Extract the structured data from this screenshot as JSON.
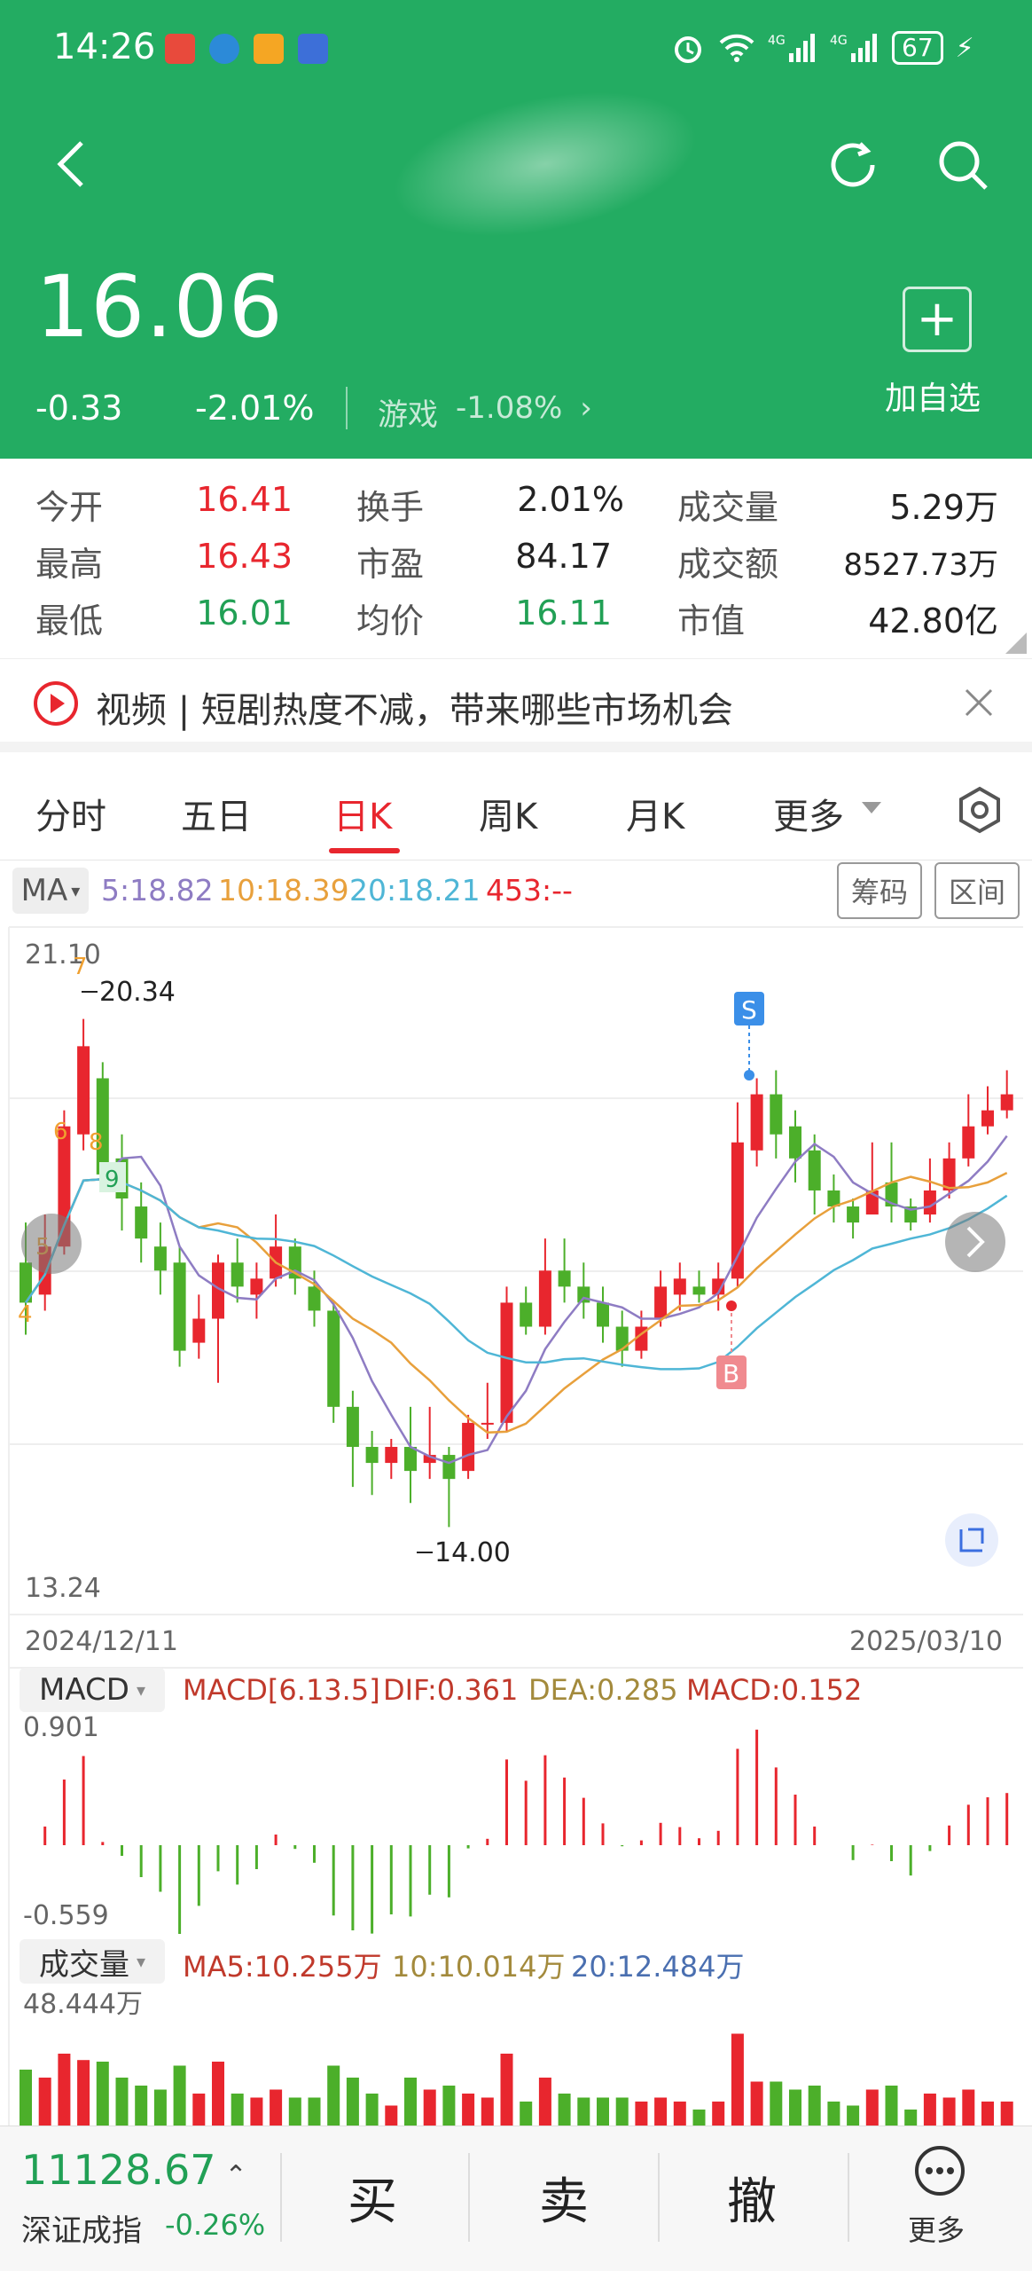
{
  "status_bar": {
    "time": "14:26",
    "battery": "67"
  },
  "header": {
    "price": "16.06",
    "change": "-0.33",
    "change_pct": "-2.01%",
    "sector_name": "游戏",
    "sector_pct": "-1.08%",
    "add_label": "加自选"
  },
  "quote": {
    "rows": [
      {
        "l1": "今开",
        "v1": "16.41",
        "l2": "换手",
        "v2": "2.01%",
        "l3": "成交量",
        "v3": "5.29万"
      },
      {
        "l1": "最高",
        "v1": "16.43",
        "l2": "市盈",
        "v2": "84.17",
        "l3": "成交额",
        "v3": "8527.73万"
      },
      {
        "l1": "最低",
        "v1": "16.01",
        "l2": "均价",
        "v2": "16.11",
        "l3": "市值",
        "v3": "42.80亿"
      }
    ]
  },
  "news": {
    "text": "视频 | 短剧热度不减，带来哪些市场机会"
  },
  "tabs": [
    "分时",
    "五日",
    "日K",
    "周K",
    "月K",
    "更多"
  ],
  "active_tab": "日K",
  "ma_bar": {
    "label": "MA",
    "ma5": "5:18.82",
    "ma10": "10:18.39",
    "ma20": "20:18.21",
    "ma453": "453:--",
    "chip_btn": "筹码",
    "range_btn": "区间"
  },
  "kline": {
    "y_max": "21.10",
    "y_min": "13.24",
    "y_mid": "17.17",
    "high_label": "20.34",
    "low_label": "14.00",
    "date_start": "2024/12/11",
    "date_end": "2025/03/10",
    "marker_s": "S",
    "marker_b": "B",
    "seq_labels": [
      "4",
      "5",
      "6",
      "7",
      "8",
      "9"
    ]
  },
  "macd_bar": {
    "label": "MACD",
    "params": "MACD[6.13.5]",
    "dif": "DIF:0.361",
    "dea": "DEA:0.285",
    "macd": "MACD:0.152",
    "y_max": "0.901",
    "y_min": "-0.559"
  },
  "vol_bar": {
    "label": "成交量",
    "ma5": "MA5:10.255万",
    "ma10": "10:10.014万",
    "ma20": "20:12.484万",
    "y_max": "48.444万"
  },
  "bottom": {
    "index_value": "11128.67",
    "index_name": "深证成指",
    "index_pct": "-0.26%",
    "buy": "买",
    "sell": "卖",
    "cancel": "撤",
    "more": "更多"
  },
  "colors": {
    "up": "#e8262e",
    "down": "#4caf2a",
    "header_green": "#23ac62",
    "ma5": "#8e7cc3",
    "ma10": "#e8a03c",
    "ma20": "#4fb6d6"
  },
  "chart_data": {
    "type": "candlestick",
    "date_start": "2024/12/11",
    "date_end": "2025/03/10",
    "ylim": [
      13.24,
      21.1
    ],
    "candles": [
      [
        17.3,
        16.8,
        17.8,
        16.4
      ],
      [
        16.9,
        17.5,
        17.9,
        16.7
      ],
      [
        17.5,
        19.0,
        19.2,
        17.4
      ],
      [
        18.9,
        20.0,
        20.34,
        18.7
      ],
      [
        19.6,
        18.4,
        19.8,
        18.2
      ],
      [
        18.6,
        18.1,
        18.9,
        17.7
      ],
      [
        18.0,
        17.6,
        18.3,
        17.3
      ],
      [
        17.5,
        17.2,
        17.8,
        16.9
      ],
      [
        17.3,
        16.2,
        17.5,
        16.0
      ],
      [
        16.3,
        16.6,
        16.9,
        16.1
      ],
      [
        16.6,
        17.3,
        17.4,
        15.8
      ],
      [
        17.3,
        17.0,
        17.6,
        16.8
      ],
      [
        16.9,
        17.1,
        17.3,
        16.6
      ],
      [
        17.1,
        17.5,
        17.9,
        17.0
      ],
      [
        17.5,
        17.1,
        17.6,
        16.9
      ],
      [
        17.0,
        16.7,
        17.2,
        16.5
      ],
      [
        16.7,
        15.5,
        16.8,
        15.3
      ],
      [
        15.5,
        15.0,
        15.7,
        14.5
      ],
      [
        15.0,
        14.8,
        15.2,
        14.4
      ],
      [
        14.8,
        15.0,
        15.1,
        14.6
      ],
      [
        15.0,
        14.7,
        15.5,
        14.3
      ],
      [
        14.8,
        14.9,
        15.5,
        14.6
      ],
      [
        14.9,
        14.6,
        15.0,
        14.0
      ],
      [
        14.7,
        15.3,
        15.4,
        14.6
      ],
      [
        15.3,
        15.3,
        15.8,
        15.1
      ],
      [
        15.3,
        16.8,
        17.0,
        15.2
      ],
      [
        16.8,
        16.5,
        17.0,
        16.4
      ],
      [
        16.5,
        17.2,
        17.6,
        16.4
      ],
      [
        17.2,
        17.0,
        17.6,
        16.8
      ],
      [
        17.0,
        16.8,
        17.3,
        16.6
      ],
      [
        16.8,
        16.5,
        17.0,
        16.3
      ],
      [
        16.5,
        16.2,
        16.7,
        16.0
      ],
      [
        16.2,
        16.5,
        16.7,
        16.1
      ],
      [
        16.6,
        17.0,
        17.2,
        16.5
      ],
      [
        16.9,
        17.1,
        17.3,
        16.7
      ],
      [
        17.0,
        16.9,
        17.2,
        16.8
      ],
      [
        16.9,
        17.1,
        17.3,
        16.7
      ],
      [
        17.1,
        18.8,
        19.3,
        17.0
      ],
      [
        18.7,
        19.4,
        19.6,
        18.5
      ],
      [
        19.4,
        18.9,
        19.7,
        18.6
      ],
      [
        19.0,
        18.6,
        19.2,
        18.3
      ],
      [
        18.7,
        18.2,
        18.9,
        17.9
      ],
      [
        18.2,
        18.0,
        18.4,
        17.8
      ],
      [
        18.0,
        17.8,
        18.1,
        17.6
      ],
      [
        17.9,
        18.2,
        18.8,
        17.9
      ],
      [
        18.3,
        18.0,
        18.8,
        17.8
      ],
      [
        18.0,
        17.8,
        18.1,
        17.7
      ],
      [
        17.9,
        18.2,
        18.6,
        17.8
      ],
      [
        18.2,
        18.6,
        18.8,
        18.1
      ],
      [
        18.6,
        19.0,
        19.4,
        18.5
      ],
      [
        19.0,
        19.2,
        19.5,
        18.9
      ],
      [
        19.2,
        19.4,
        19.7,
        19.1
      ]
    ],
    "high_marker": 20.34,
    "low_marker": 14.0
  }
}
